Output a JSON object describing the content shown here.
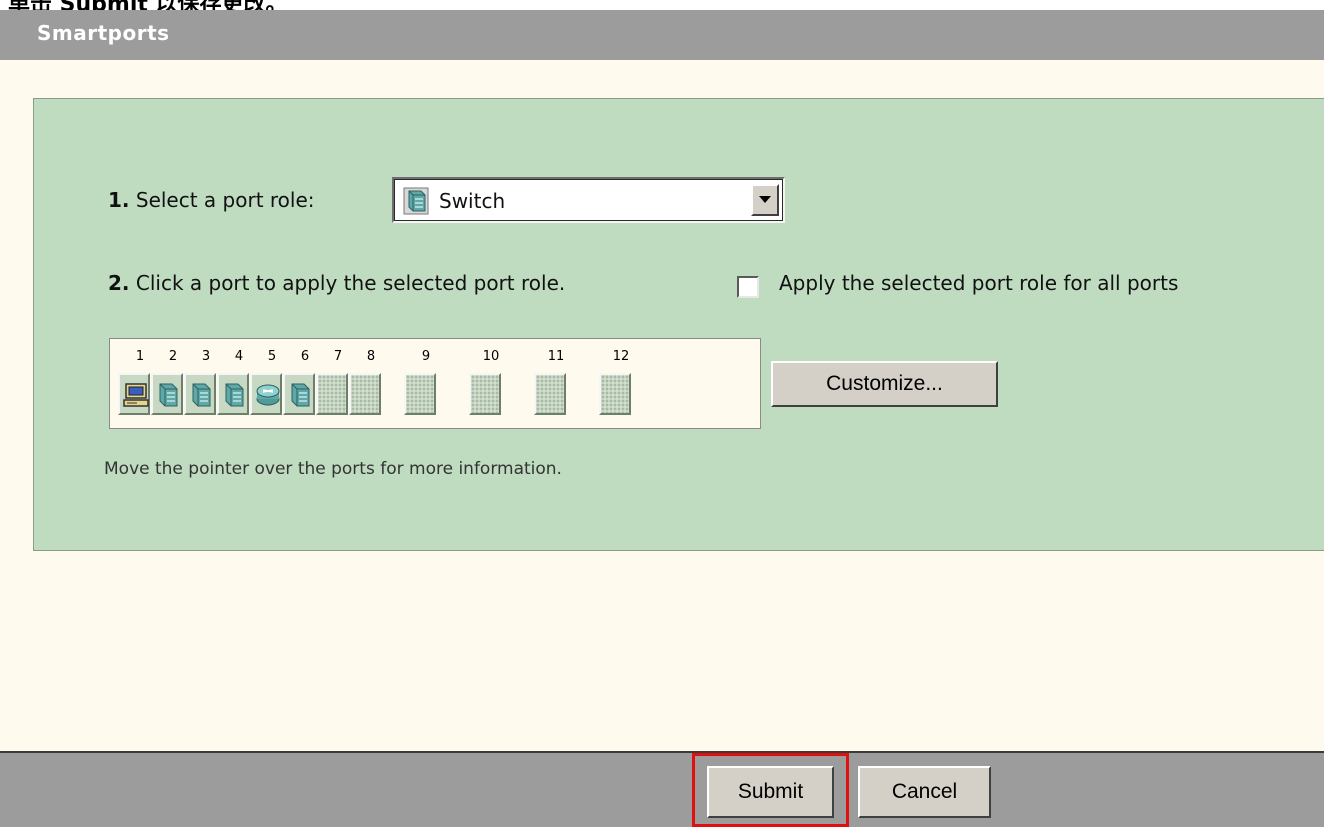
{
  "caption": {
    "text": "单击 Submit 以保存更改。"
  },
  "header": {
    "title": "Smartports"
  },
  "step1": {
    "number": "1.",
    "text": " Select a port role:"
  },
  "role_select": {
    "value": "Switch",
    "icon": "switch-icon"
  },
  "step2": {
    "number": "2.",
    "text": " Click a port to apply the selected port role."
  },
  "apply_all": {
    "label": "Apply the selected port role for all ports",
    "checked": false
  },
  "ports": [
    {
      "number": "1",
      "role": "desktop-icon"
    },
    {
      "number": "2",
      "role": "switch-icon"
    },
    {
      "number": "3",
      "role": "switch-icon"
    },
    {
      "number": "4",
      "role": "switch-icon"
    },
    {
      "number": "5",
      "role": "router-icon"
    },
    {
      "number": "6",
      "role": "switch-icon"
    },
    {
      "number": "7",
      "role": "none"
    },
    {
      "number": "8",
      "role": "none"
    },
    {
      "number": "9",
      "role": "none"
    },
    {
      "number": "10",
      "role": "none"
    },
    {
      "number": "11",
      "role": "none"
    },
    {
      "number": "12",
      "role": "none"
    }
  ],
  "customize_button": {
    "label": "Customize..."
  },
  "hint": {
    "text": "Move the pointer over the ports for more information."
  },
  "footer": {
    "submit_label": "Submit",
    "cancel_label": "Cancel"
  },
  "colors": {
    "header": "#9c9c9c",
    "panel": "#bfdcc1",
    "background": "#fffaee",
    "highlight": "#e01010"
  }
}
